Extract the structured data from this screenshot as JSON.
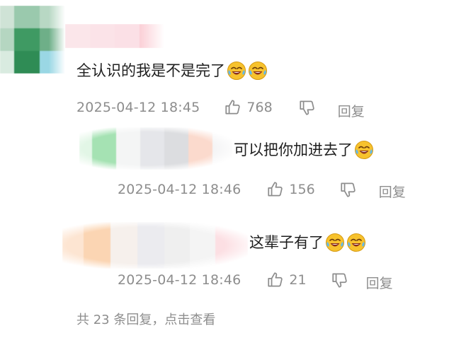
{
  "top_comment": {
    "text": "全认识的我是不是完了",
    "emojis": [
      "laugh-cry-emoji",
      "laugh-cry-emoji"
    ],
    "time": "2025-04-12 18:45",
    "likes": "768",
    "reply_label": "回复"
  },
  "replies": [
    {
      "text": "可以把你加进去了",
      "emojis": [
        "laugh-cry-emoji"
      ],
      "time": "2025-04-12 18:46",
      "likes": "156",
      "reply_label": "回复"
    },
    {
      "text": "这辈子有了",
      "emojis": [
        "laugh-cry-emoji",
        "laugh-cry-emoji"
      ],
      "time": "2025-04-12 18:46",
      "likes": "21",
      "reply_label": "回复"
    }
  ],
  "more_replies": "共 23 条回复，点击查看",
  "icons": {
    "like": "thumbs-up-icon",
    "dislike": "thumbs-down-icon"
  },
  "colors": {
    "text": "#1e1e1e",
    "meta": "#8d8d8d",
    "emoji_face": "#f7c22d"
  }
}
